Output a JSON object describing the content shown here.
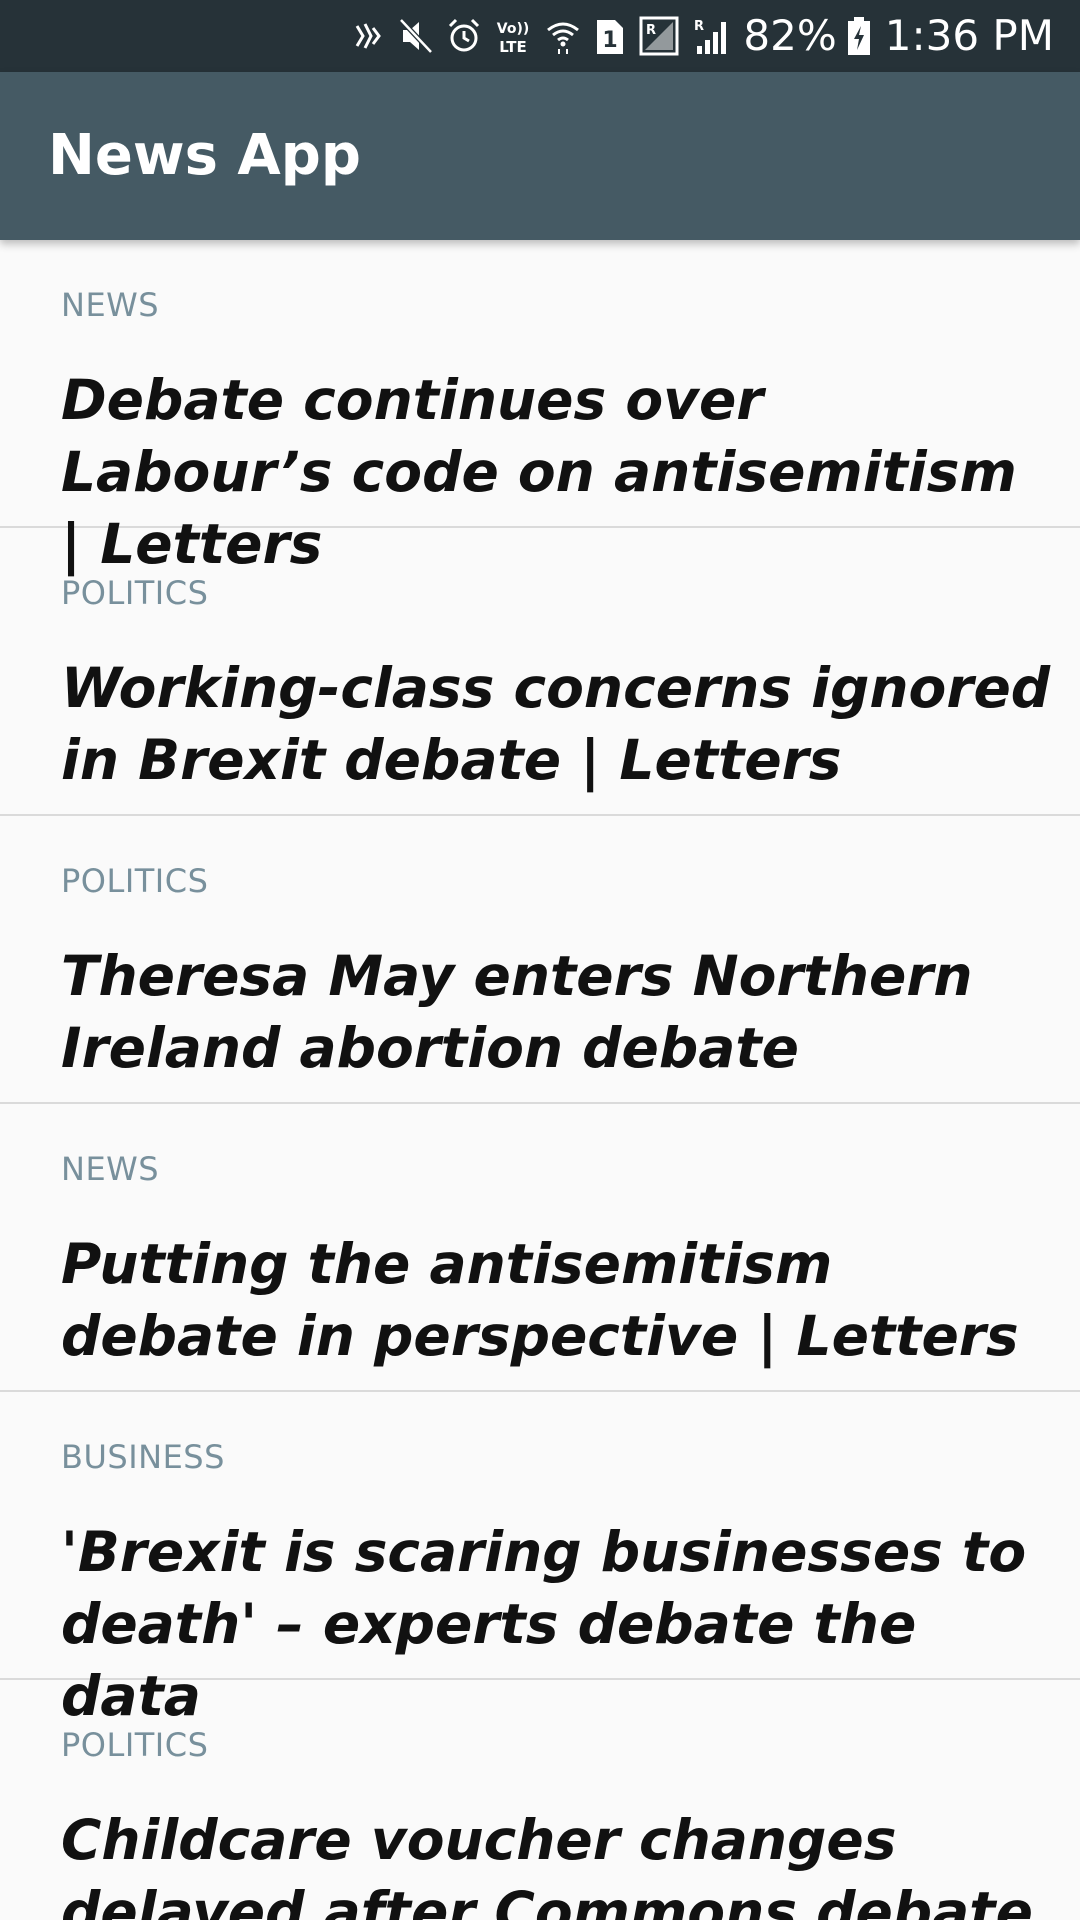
{
  "status_bar": {
    "icons": [
      "nfc-icon",
      "mute-icon",
      "alarm-icon",
      "volte-icon",
      "wifi-icon",
      "sim1-icon",
      "roaming-signal-icon",
      "signal-icon",
      "battery-charging-icon"
    ],
    "volte_label": "Vo)) LTE",
    "sim_label": "1",
    "roaming_label": "R",
    "battery_percent": "82%",
    "time": "1:36 PM"
  },
  "app_bar": {
    "title": "News App"
  },
  "articles": [
    {
      "section": "NEWS",
      "title": "Debate continues over Labour’s code on antisemitism | Letters"
    },
    {
      "section": "POLITICS",
      "title": "Working-class concerns ignored in Brexit debate | Letters"
    },
    {
      "section": "POLITICS",
      "title": "Theresa May enters Northern Ireland abortion debate"
    },
    {
      "section": "NEWS",
      "title": "Putting the antisemitism debate in perspective | Letters"
    },
    {
      "section": "BUSINESS",
      "title": "'Brexit is scaring businesses to death' –  experts debate the data"
    },
    {
      "section": "POLITICS",
      "title": "Childcare voucher changes delayed after Commons debate"
    }
  ],
  "colors": {
    "status_bar": "#263238",
    "app_bar": "#455a64",
    "section_label": "#78909c",
    "headline": "#111111",
    "background": "#fafafa",
    "divider": "#dadada"
  }
}
